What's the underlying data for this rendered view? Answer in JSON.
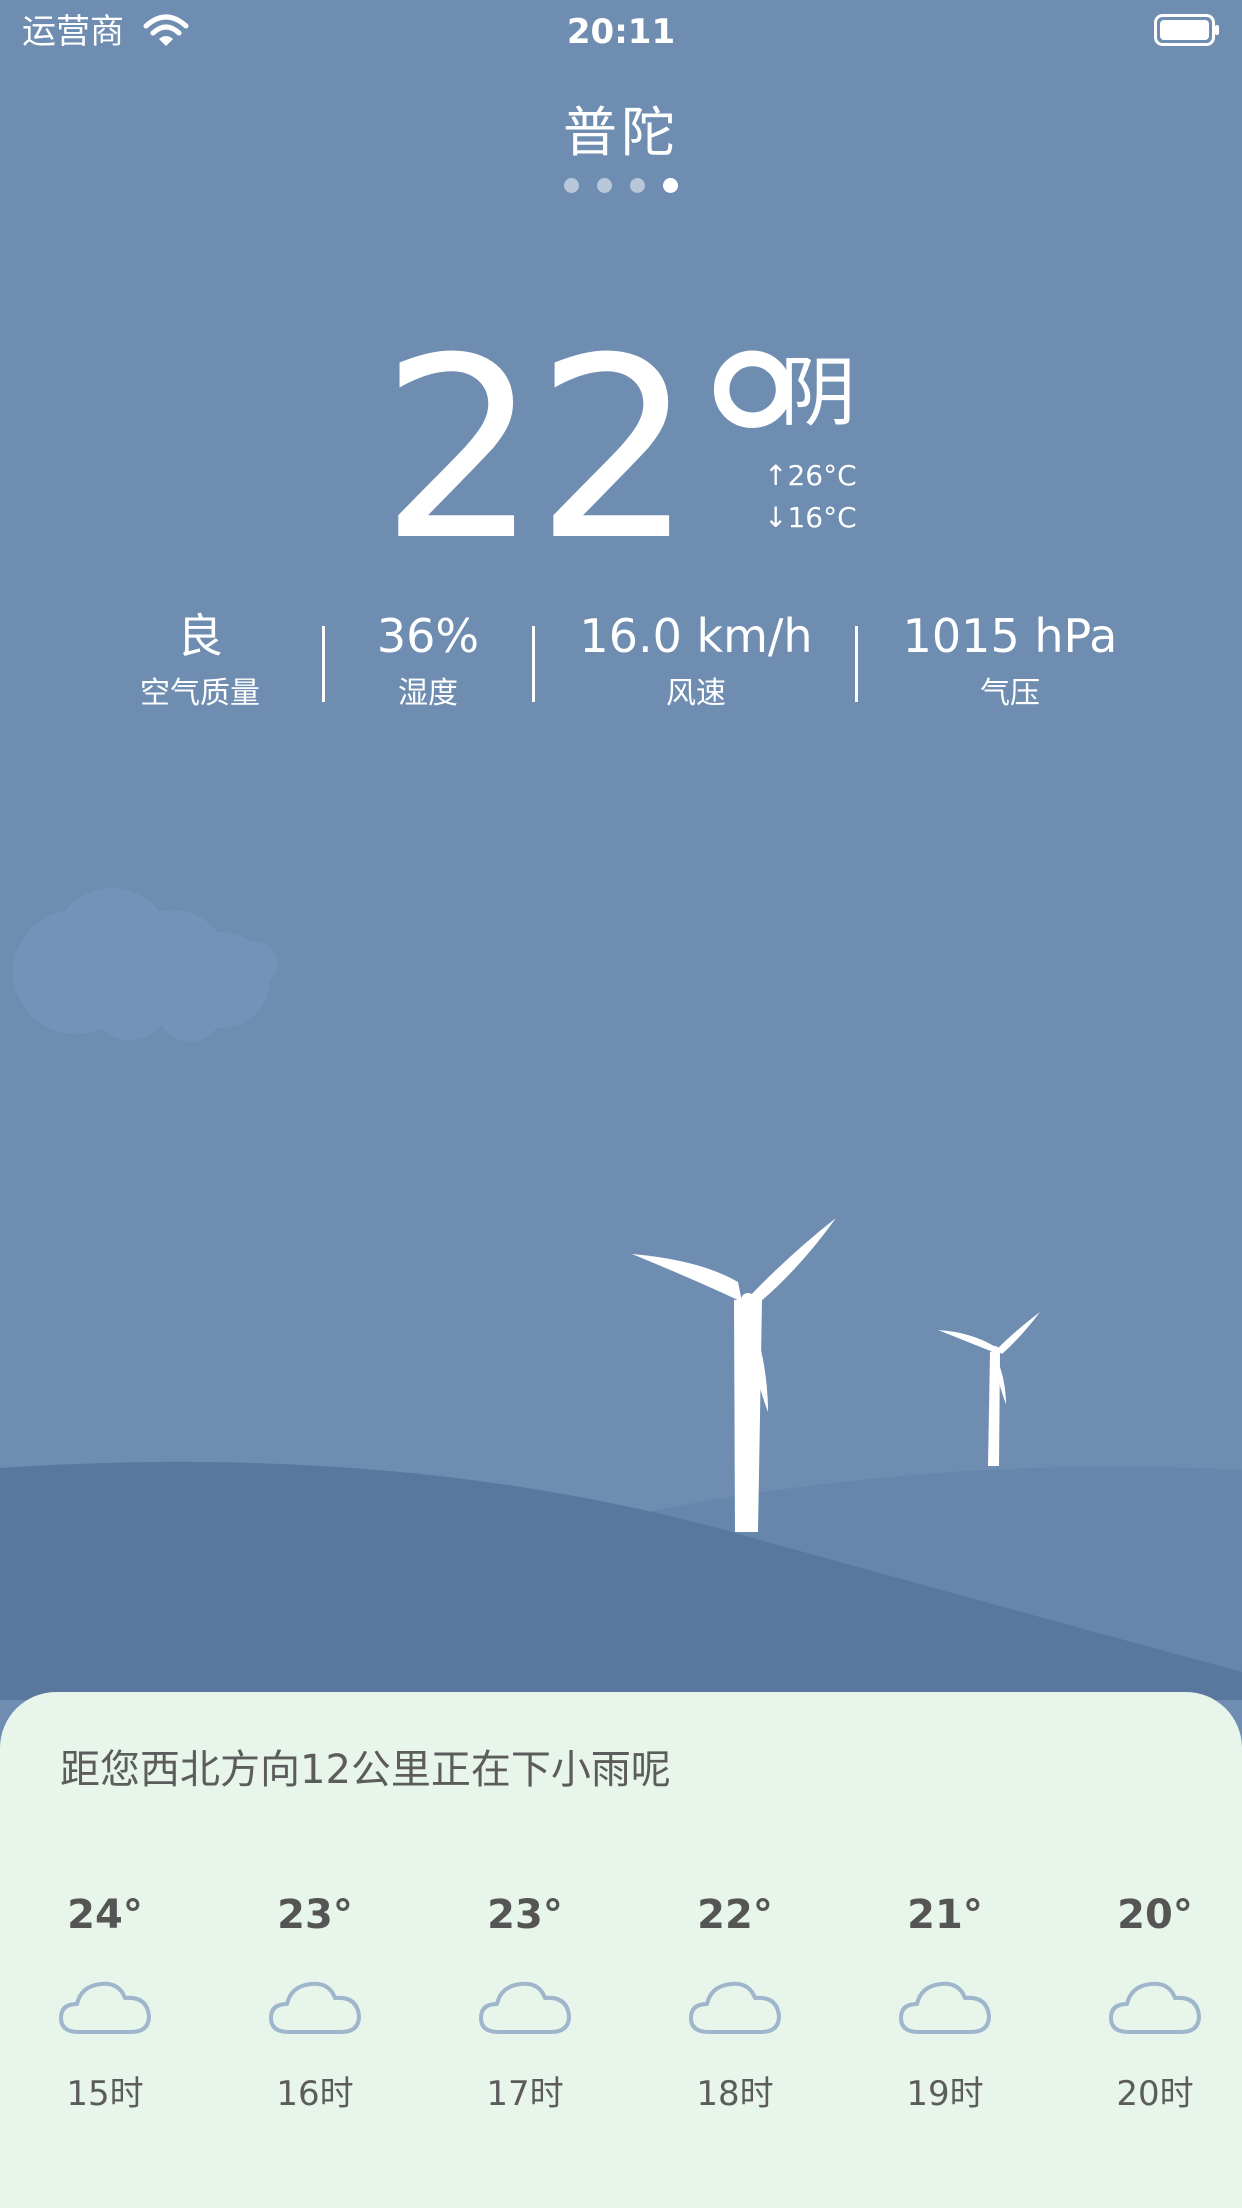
{
  "status_bar": {
    "carrier": "运营商",
    "time": "20:11"
  },
  "header": {
    "city": "普陀",
    "page_count": 4,
    "active_page": 4
  },
  "current": {
    "temperature": "22°",
    "condition": "阴",
    "high": "↑26°C",
    "low": "↓16°C"
  },
  "stats": {
    "air_quality_value": "良",
    "air_quality_label": "空气质量",
    "humidity_value": "36%",
    "humidity_label": "湿度",
    "wind_value": "16.0 km/h",
    "wind_label": "风速",
    "pressure_value": "1015 hPa",
    "pressure_label": "气压"
  },
  "forecast": {
    "notice": "距您西北方向12公里正在下小雨呢",
    "hours": [
      {
        "temp": "24°",
        "label": "15时",
        "icon": "cloud-icon"
      },
      {
        "temp": "23°",
        "label": "16时",
        "icon": "cloud-icon"
      },
      {
        "temp": "23°",
        "label": "17时",
        "icon": "cloud-icon"
      },
      {
        "temp": "22°",
        "label": "18时",
        "icon": "cloud-icon"
      },
      {
        "temp": "21°",
        "label": "19时",
        "icon": "cloud-icon"
      },
      {
        "temp": "20°",
        "label": "20时",
        "icon": "cloud-icon"
      }
    ]
  },
  "colors": {
    "sky": "#6e8db1",
    "hill_front": "#5a779e",
    "hill_back": "#6786ab",
    "card": "#e8f5ea",
    "cloud_outline": "#9fb6cc"
  }
}
